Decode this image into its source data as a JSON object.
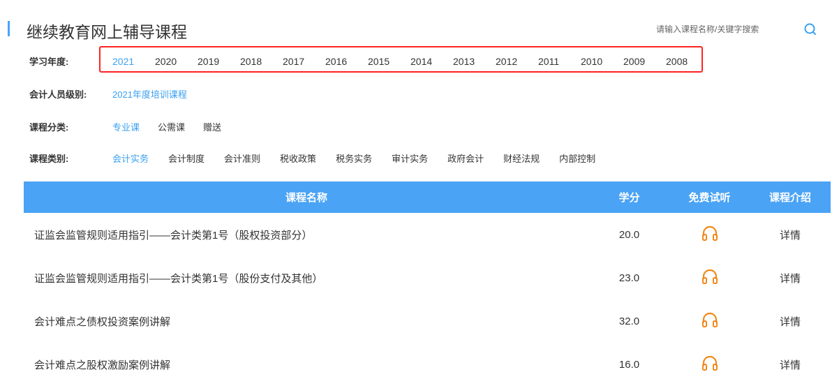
{
  "header": {
    "title": "继续教育网上辅导课程",
    "search_placeholder": "请输入课程名称/关键字搜索"
  },
  "filters": {
    "year": {
      "label": "学习年度:",
      "options": [
        "2021",
        "2020",
        "2019",
        "2018",
        "2017",
        "2016",
        "2015",
        "2014",
        "2013",
        "2012",
        "2011",
        "2010",
        "2009",
        "2008"
      ],
      "selected": "2021"
    },
    "level": {
      "label": "会计人员级别:",
      "options": [
        "2021年度培训课程"
      ]
    },
    "category": {
      "label": "课程分类:",
      "options": [
        "专业课",
        "公需课",
        "赠送"
      ]
    },
    "type": {
      "label": "课程类别:",
      "options": [
        "会计实务",
        "会计制度",
        "会计准则",
        "税收政策",
        "税务实务",
        "审计实务",
        "政府会计",
        "财经法规",
        "内部控制"
      ]
    }
  },
  "table": {
    "headers": [
      "课程名称",
      "学分",
      "免费试听",
      "课程介绍"
    ],
    "rows": [
      {
        "name": "证监会监管规则适用指引——会计类第1号（股权投资部分）",
        "credit": "20.0",
        "detail": "详情"
      },
      {
        "name": "证监会监管规则适用指引——会计类第1号（股份支付及其他）",
        "credit": "23.0",
        "detail": "详情"
      },
      {
        "name": "会计难点之债权投资案例讲解",
        "credit": "32.0",
        "detail": "详情"
      },
      {
        "name": "会计难点之股权激励案例讲解",
        "credit": "16.0",
        "detail": "详情"
      }
    ]
  },
  "colors": {
    "accent": "#4aa3f5",
    "highlight": "#ff2222",
    "icon": "#f08a1c"
  }
}
